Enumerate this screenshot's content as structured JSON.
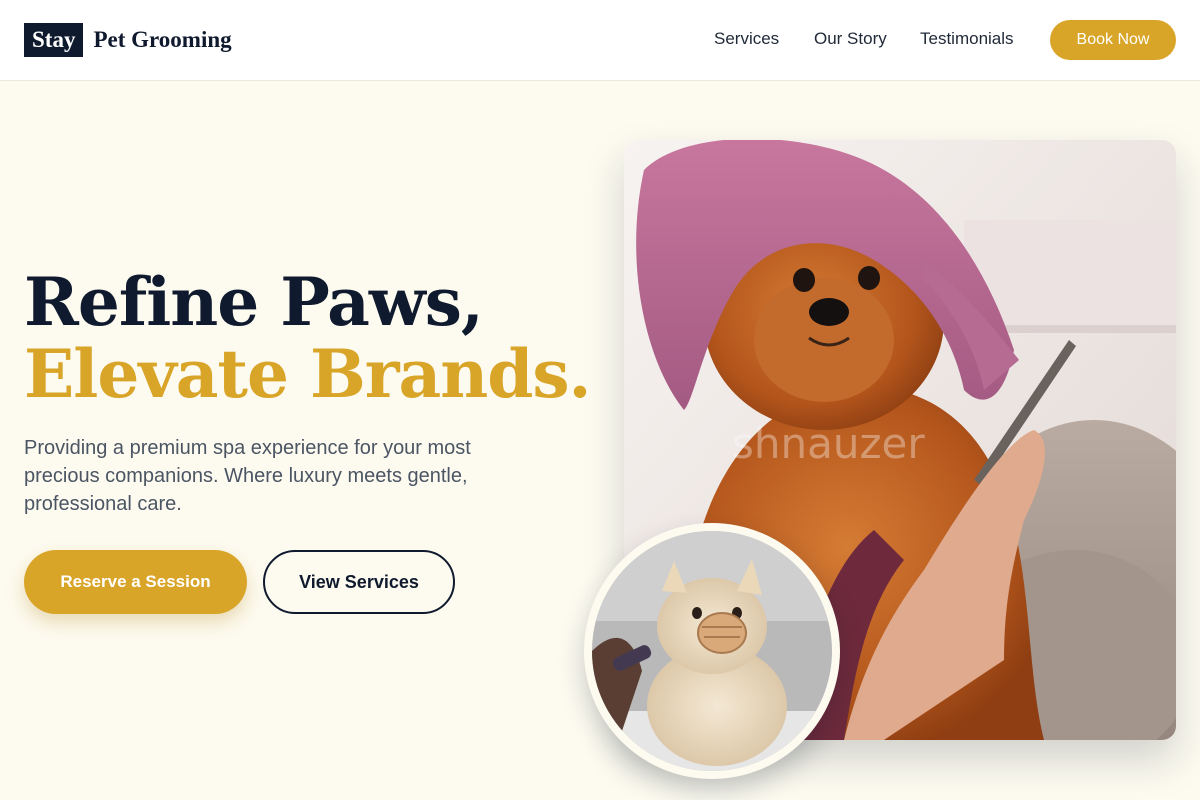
{
  "brand": {
    "badge": "Stay",
    "name": "Pet Grooming"
  },
  "nav": {
    "links": [
      "Services",
      "Our Story",
      "Testimonials"
    ],
    "cta": "Book Now"
  },
  "hero": {
    "headline_line1": "Refine Paws,",
    "headline_line2": "Elevate Brands.",
    "subtext": "Providing a premium spa experience for your most precious companions. Where luxury meets gentle, professional care.",
    "primary_cta": "Reserve a Session",
    "secondary_cta": "View Services"
  },
  "images": {
    "main": "pomeranian-with-pink-towel-being-combed",
    "inset": "pomeranian-with-muzzle-being-groomed",
    "watermark": "shnauzer"
  },
  "colors": {
    "navy": "#0f1a2e",
    "gold": "#d9a528",
    "cream": "#fdfbf0",
    "body_text": "#4b5563"
  }
}
